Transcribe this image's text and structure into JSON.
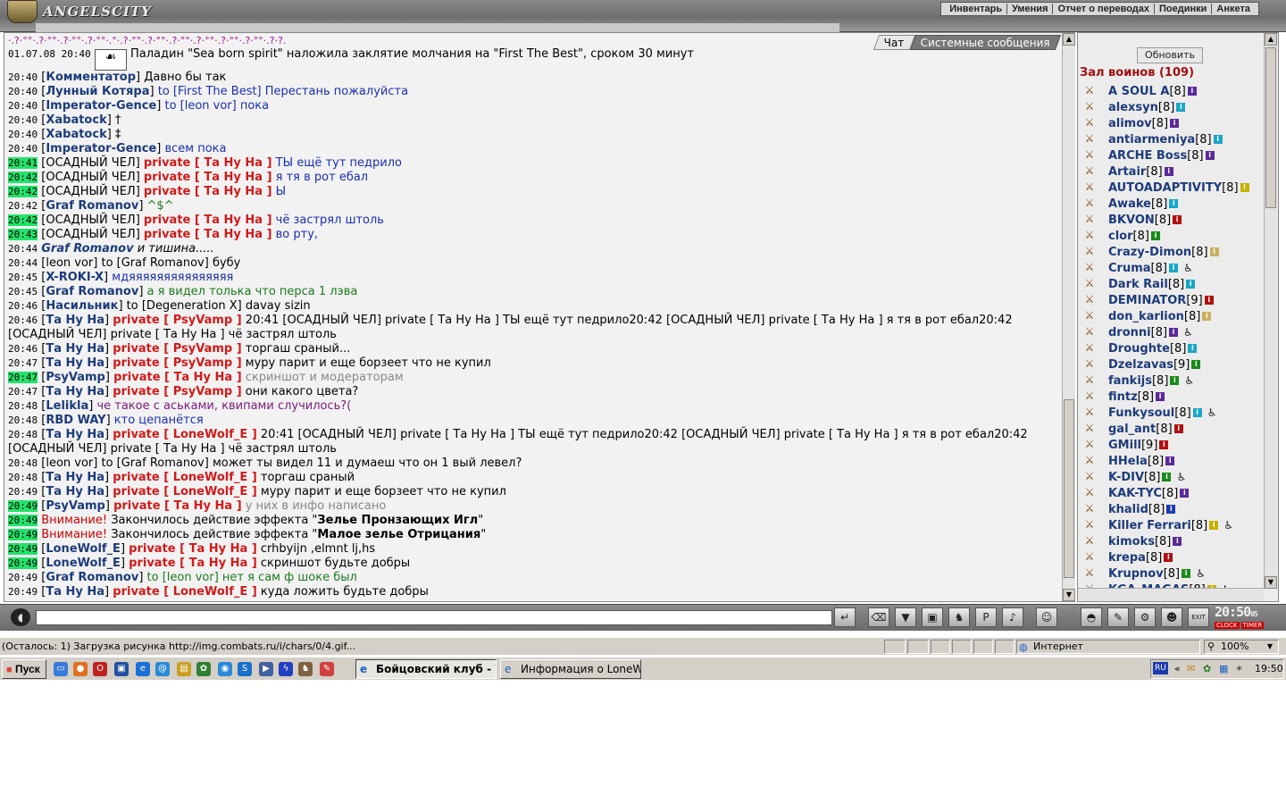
{
  "app": {
    "logo_text": "ANGELSCITY",
    "menu": [
      "Инвентарь",
      "Умения",
      "Отчет о переводах",
      "Поединки",
      "Анкета"
    ]
  },
  "chat": {
    "tabs": {
      "chat": "Чат",
      "system": "Системные сообщения"
    },
    "header_pattern": "·.?·°°·.?·°°·.?·°°·.?·°°·.°·.?·°°·.?·°°·.?·°°·.?·°°·.?·°°·.?·°°·.?·?.",
    "lines": [
      {
        "time": "01.07.08 20:40",
        "hl": false,
        "spell_icon": true,
        "parts": [
          {
            "c": "plain",
            "v": " Паладин \"Sea born spirit\" наложила заклятие молчания на \"First The Best\", сроком 30 минут"
          }
        ]
      },
      {
        "time": "20:40",
        "hl": false,
        "parts": [
          {
            "c": "plain",
            "v": "["
          },
          {
            "c": "nick",
            "v": "Комментатор"
          },
          {
            "c": "plain",
            "v": "] Давно бы так"
          }
        ]
      },
      {
        "time": "20:40",
        "hl": false,
        "parts": [
          {
            "c": "plain",
            "v": "["
          },
          {
            "c": "nick",
            "v": "Лунный Котяра"
          },
          {
            "c": "plain",
            "v": "] "
          },
          {
            "c": "txt-pv",
            "v": "to [First The Best] Перестань пожалуйста"
          }
        ]
      },
      {
        "time": "20:40",
        "hl": false,
        "parts": [
          {
            "c": "plain",
            "v": "["
          },
          {
            "c": "nick",
            "v": "Imperator-Gence"
          },
          {
            "c": "plain",
            "v": "] "
          },
          {
            "c": "txt-pv",
            "v": "to [leon vor] пока"
          }
        ]
      },
      {
        "time": "20:40",
        "hl": false,
        "parts": [
          {
            "c": "plain",
            "v": "["
          },
          {
            "c": "nick",
            "v": "Xabatock"
          },
          {
            "c": "plain",
            "v": "] †"
          }
        ]
      },
      {
        "time": "20:40",
        "hl": false,
        "parts": [
          {
            "c": "plain",
            "v": "["
          },
          {
            "c": "nick",
            "v": "Xabatock"
          },
          {
            "c": "plain",
            "v": "] ‡"
          }
        ]
      },
      {
        "time": "20:40",
        "hl": false,
        "parts": [
          {
            "c": "plain",
            "v": "["
          },
          {
            "c": "nick",
            "v": "Imperator-Gence"
          },
          {
            "c": "plain",
            "v": "] "
          },
          {
            "c": "txt-pv",
            "v": "всем пока"
          }
        ]
      },
      {
        "time": "20:41",
        "hl": true,
        "parts": [
          {
            "c": "plain",
            "v": "[ОСАДНЫЙ ЧЕЛ] "
          },
          {
            "c": "pv",
            "v": "private [ Та Ну На ]"
          },
          {
            "c": "txt-pv",
            "v": " ТЫ ещё тут педрило"
          }
        ]
      },
      {
        "time": "20:42",
        "hl": true,
        "parts": [
          {
            "c": "plain",
            "v": "[ОСАДНЫЙ ЧЕЛ] "
          },
          {
            "c": "pv",
            "v": "private [ Та Ну На ]"
          },
          {
            "c": "txt-pv",
            "v": " я тя в рот ебал"
          }
        ]
      },
      {
        "time": "20:42",
        "hl": true,
        "parts": [
          {
            "c": "plain",
            "v": "[ОСАДНЫЙ ЧЕЛ] "
          },
          {
            "c": "pv",
            "v": "private [ Та Ну На ]"
          },
          {
            "c": "txt-pv",
            "v": " Ы"
          }
        ]
      },
      {
        "time": "20:42",
        "hl": false,
        "parts": [
          {
            "c": "plain",
            "v": "["
          },
          {
            "c": "nick",
            "v": "Graf Romanov"
          },
          {
            "c": "plain",
            "v": "] "
          },
          {
            "c": "txt-g",
            "v": "^$^"
          }
        ]
      },
      {
        "time": "20:42",
        "hl": true,
        "parts": [
          {
            "c": "plain",
            "v": "[ОСАДНЫЙ ЧЕЛ] "
          },
          {
            "c": "pv",
            "v": "private [ Та Ну На ]"
          },
          {
            "c": "txt-pv",
            "v": " чё застрял штоль"
          }
        ]
      },
      {
        "time": "20:43",
        "hl": true,
        "parts": [
          {
            "c": "plain",
            "v": "[ОСАДНЫЙ ЧЕЛ] "
          },
          {
            "c": "pv",
            "v": "private [ Та Ну На ]"
          },
          {
            "c": "txt-pv",
            "v": " во рту,"
          }
        ]
      },
      {
        "time": "20:44",
        "hl": false,
        "parts": [
          {
            "c": "nick it",
            "v": "Graf Romanov"
          },
          {
            "c": "it",
            "v": " и тишина....."
          }
        ]
      },
      {
        "time": "20:44",
        "hl": false,
        "parts": [
          {
            "c": "plain",
            "v": "[leon vor] to [Graf Romanov] бубу"
          }
        ]
      },
      {
        "time": "20:45",
        "hl": false,
        "parts": [
          {
            "c": "plain",
            "v": "["
          },
          {
            "c": "nick",
            "v": "X-ROKI-X"
          },
          {
            "c": "plain",
            "v": "] "
          },
          {
            "c": "txt-pv",
            "v": "мдяяяяяяяяяяяяяяя"
          }
        ]
      },
      {
        "time": "20:45",
        "hl": false,
        "parts": [
          {
            "c": "plain",
            "v": "["
          },
          {
            "c": "nick",
            "v": "Graf Romanov"
          },
          {
            "c": "plain",
            "v": "] "
          },
          {
            "c": "txt-g",
            "v": "а я видел толька что перса 1 лэва"
          }
        ]
      },
      {
        "time": "20:46",
        "hl": false,
        "parts": [
          {
            "c": "plain",
            "v": "["
          },
          {
            "c": "nick",
            "v": "Насильник"
          },
          {
            "c": "plain",
            "v": "] to [Degeneration X] davay sizin"
          }
        ]
      },
      {
        "time": "20:46",
        "hl": false,
        "parts": [
          {
            "c": "plain",
            "v": "["
          },
          {
            "c": "nick",
            "v": "Та Ну На"
          },
          {
            "c": "plain",
            "v": "] "
          },
          {
            "c": "pv",
            "v": "private [ PsyVamp ]"
          },
          {
            "c": "plain",
            "v": " 20:41 [ОСАДНЫЙ ЧЕЛ] private [ Та Ну На ] ТЫ ещё тут педрило20:42 [ОСАДНЫЙ ЧЕЛ] private [ Та Ну На ] я тя в рот ебал20:42 [ОСАДНЫЙ ЧЕЛ] private [ Та Ну На ] чё застрял штоль"
          }
        ]
      },
      {
        "time": "20:46",
        "hl": false,
        "parts": [
          {
            "c": "plain",
            "v": "["
          },
          {
            "c": "nick",
            "v": "Та Ну На"
          },
          {
            "c": "plain",
            "v": "] "
          },
          {
            "c": "pv",
            "v": "private [ PsyVamp ]"
          },
          {
            "c": "plain",
            "v": " торгаш сраный..."
          }
        ]
      },
      {
        "time": "20:47",
        "hl": false,
        "parts": [
          {
            "c": "plain",
            "v": "["
          },
          {
            "c": "nick",
            "v": "Та Ну На"
          },
          {
            "c": "plain",
            "v": "] "
          },
          {
            "c": "pv",
            "v": "private [ PsyVamp ]"
          },
          {
            "c": "plain",
            "v": " муру парит и еще борзеет что не купил"
          }
        ]
      },
      {
        "time": "20:47",
        "hl": true,
        "parts": [
          {
            "c": "plain",
            "v": "["
          },
          {
            "c": "nick",
            "v": "PsyVamp"
          },
          {
            "c": "plain",
            "v": "] "
          },
          {
            "c": "pv",
            "v": "private [ Та Ну На ]"
          },
          {
            "c": "txt-gray",
            "v": " скриншот и модераторам"
          }
        ]
      },
      {
        "time": "20:47",
        "hl": false,
        "parts": [
          {
            "c": "plain",
            "v": "["
          },
          {
            "c": "nick",
            "v": "Та Ну На"
          },
          {
            "c": "plain",
            "v": "] "
          },
          {
            "c": "pv",
            "v": "private [ PsyVamp ]"
          },
          {
            "c": "plain",
            "v": " они какого цвета?"
          }
        ]
      },
      {
        "time": "20:48",
        "hl": false,
        "parts": [
          {
            "c": "plain",
            "v": "["
          },
          {
            "c": "nick",
            "v": "Lelikla"
          },
          {
            "c": "plain",
            "v": "] "
          },
          {
            "c": "txt-purple",
            "v": "че такое с аськами, квипами случилось?("
          }
        ]
      },
      {
        "time": "20:48",
        "hl": false,
        "parts": [
          {
            "c": "plain",
            "v": "["
          },
          {
            "c": "nick",
            "v": "RBD WAY"
          },
          {
            "c": "plain",
            "v": "] "
          },
          {
            "c": "txt-pv",
            "v": "кто цепанётся"
          }
        ]
      },
      {
        "time": "20:48",
        "hl": false,
        "parts": [
          {
            "c": "plain",
            "v": "["
          },
          {
            "c": "nick",
            "v": "Та Ну На"
          },
          {
            "c": "plain",
            "v": "] "
          },
          {
            "c": "pv",
            "v": "private [ LoneWolf_E ]"
          },
          {
            "c": "plain",
            "v": " 20:41 [ОСАДНЫЙ ЧЕЛ] private [ Та Ну На ] ТЫ ещё тут педрило20:42 [ОСАДНЫЙ ЧЕЛ] private [ Та Ну На ] я тя в рот ебал20:42 [ОСАДНЫЙ ЧЕЛ] private [ Та Ну На ] чё застрял штоль"
          }
        ]
      },
      {
        "time": "20:48",
        "hl": false,
        "parts": [
          {
            "c": "plain",
            "v": "[leon vor] to [Graf Romanov] может ты видел 11 и думаеш что он 1 вый левел?"
          }
        ]
      },
      {
        "time": "20:48",
        "hl": false,
        "parts": [
          {
            "c": "plain",
            "v": "["
          },
          {
            "c": "nick",
            "v": "Та Ну На"
          },
          {
            "c": "plain",
            "v": "] "
          },
          {
            "c": "pv",
            "v": "private [ LoneWolf_E ]"
          },
          {
            "c": "plain",
            "v": " торгаш сраный"
          }
        ]
      },
      {
        "time": "20:49",
        "hl": false,
        "parts": [
          {
            "c": "plain",
            "v": "["
          },
          {
            "c": "nick",
            "v": "Та Ну На"
          },
          {
            "c": "plain",
            "v": "] "
          },
          {
            "c": "pv",
            "v": "private [ LoneWolf_E ]"
          },
          {
            "c": "plain",
            "v": " муру парит и еще борзеет что не купил"
          }
        ]
      },
      {
        "time": "20:49",
        "hl": true,
        "parts": [
          {
            "c": "plain",
            "v": "["
          },
          {
            "c": "nick",
            "v": "PsyVamp"
          },
          {
            "c": "plain",
            "v": "] "
          },
          {
            "c": "pv",
            "v": "private [ Та Ну На ]"
          },
          {
            "c": "txt-gray",
            "v": " у них в инфо написано"
          }
        ]
      },
      {
        "time": "20:49",
        "hl": true,
        "parts": [
          {
            "c": "warn",
            "v": "Внимание!"
          },
          {
            "c": "plain",
            "v": " Закончилось действие эффекта \""
          },
          {
            "c": "b",
            "v": "Зелье Пронзающих Игл"
          },
          {
            "c": "plain",
            "v": "\""
          }
        ]
      },
      {
        "time": "20:49",
        "hl": true,
        "parts": [
          {
            "c": "warn",
            "v": "Внимание!"
          },
          {
            "c": "plain",
            "v": " Закончилось действие эффекта \""
          },
          {
            "c": "b",
            "v": "Малое зелье Отрицания"
          },
          {
            "c": "plain",
            "v": "\""
          }
        ]
      },
      {
        "time": "20:49",
        "hl": true,
        "parts": [
          {
            "c": "plain",
            "v": "["
          },
          {
            "c": "nick",
            "v": "LoneWolf_E"
          },
          {
            "c": "plain",
            "v": "] "
          },
          {
            "c": "pv",
            "v": "private [ Та Ну На ]"
          },
          {
            "c": "plain",
            "v": " crhbyijn ,elmnt lj,hs"
          }
        ]
      },
      {
        "time": "20:49",
        "hl": true,
        "parts": [
          {
            "c": "plain",
            "v": "["
          },
          {
            "c": "nick",
            "v": "LoneWolf_E"
          },
          {
            "c": "plain",
            "v": "] "
          },
          {
            "c": "pv",
            "v": "private [ Та Ну На ]"
          },
          {
            "c": "plain",
            "v": " скриншот будьте добры"
          }
        ]
      },
      {
        "time": "20:49",
        "hl": false,
        "parts": [
          {
            "c": "plain",
            "v": "["
          },
          {
            "c": "nick",
            "v": "Graf Romanov"
          },
          {
            "c": "plain",
            "v": "] "
          },
          {
            "c": "txt-g",
            "v": "to [leon vor] нет я сам ф шоке был"
          }
        ]
      },
      {
        "time": "20:49",
        "hl": false,
        "parts": [
          {
            "c": "plain",
            "v": "["
          },
          {
            "c": "nick",
            "v": "Та Ну На"
          },
          {
            "c": "plain",
            "v": "] "
          },
          {
            "c": "pv",
            "v": "private [ LoneWolf_E ]"
          },
          {
            "c": "plain",
            "v": " куда ложить будьте добры"
          }
        ]
      }
    ]
  },
  "sidebar": {
    "refresh_label": "Обновить",
    "hall_title": "Зал воинов (109)",
    "users": [
      {
        "name": "A SOUL A",
        "level": "[8]",
        "info": "#5a2a9a",
        "injury": false
      },
      {
        "name": "alexsyn",
        "level": "[8]",
        "info": "#19a7c8",
        "injury": false
      },
      {
        "name": "alimov",
        "level": "[8]",
        "info": "#5a2a9a",
        "injury": false
      },
      {
        "name": "antiarmeniya",
        "level": "[8]",
        "info": "#19a7c8",
        "injury": false
      },
      {
        "name": "ARCHE Boss",
        "level": "[8]",
        "info": "#5a2a9a",
        "injury": false
      },
      {
        "name": "Artair",
        "level": "[8]",
        "info": "#5a2a9a",
        "injury": false
      },
      {
        "name": "AUTOADAPTIVITY",
        "level": "[8]",
        "info": "#c8b000",
        "injury": false
      },
      {
        "name": "Awake",
        "level": "[8]",
        "info": "#19a7c8",
        "injury": false
      },
      {
        "name": "BKVON",
        "level": "[8]",
        "info": "#b01010",
        "injury": false
      },
      {
        "name": "clor",
        "level": "[8]",
        "info": "#1a8a1a",
        "injury": false
      },
      {
        "name": "Crazy-Dimon",
        "level": "[8]",
        "info": "#c8b060",
        "injury": false
      },
      {
        "name": "Cruma",
        "level": "[8]",
        "info": "#19a7c8",
        "injury": true
      },
      {
        "name": "Dark Rail",
        "level": "[8]",
        "info": "#19a7c8",
        "injury": false
      },
      {
        "name": "DEMINATOR",
        "level": "[9]",
        "info": "#b01010",
        "injury": false
      },
      {
        "name": "don_karlion",
        "level": "[8]",
        "info": "#c8b060",
        "injury": false
      },
      {
        "name": "dronni",
        "level": "[8]",
        "info": "#5a2a9a",
        "injury": true
      },
      {
        "name": "Droughte",
        "level": "[8]",
        "info": "#19a7c8",
        "injury": false
      },
      {
        "name": "Dzelzavas",
        "level": "[9]",
        "info": "#1a8a1a",
        "injury": false
      },
      {
        "name": "fankijs",
        "level": "[8]",
        "info": "#1a8a1a",
        "injury": true
      },
      {
        "name": "fintz",
        "level": "[8]",
        "info": "#5a2a9a",
        "injury": false
      },
      {
        "name": "Funkysoul",
        "level": "[8]",
        "info": "#19a7c8",
        "injury": true
      },
      {
        "name": "gal_ant",
        "level": "[8]",
        "info": "#b01010",
        "injury": false
      },
      {
        "name": "GMill",
        "level": "[9]",
        "info": "#b01010",
        "injury": false
      },
      {
        "name": "HHela",
        "level": "[8]",
        "info": "#5a2a9a",
        "injury": false
      },
      {
        "name": "K-DIV",
        "level": "[8]",
        "info": "#1a8a1a",
        "injury": true
      },
      {
        "name": "KAK-TYC",
        "level": "[8]",
        "info": "#5a2a9a",
        "injury": false
      },
      {
        "name": "khalid",
        "level": "[8]",
        "info": "#1a3ab0",
        "injury": false
      },
      {
        "name": "Killer Ferrari",
        "level": "[8]",
        "info": "#c8b000",
        "injury": true
      },
      {
        "name": "kimoks",
        "level": "[8]",
        "info": "#5a2a9a",
        "injury": false
      },
      {
        "name": "krepa",
        "level": "[8]",
        "info": "#b01010",
        "injury": false
      },
      {
        "name": "Krupnov",
        "level": "[8]",
        "info": "#1a8a1a",
        "injury": true
      },
      {
        "name": "KGA_MAGAS",
        "level": "[8]",
        "info": "#c8b000",
        "injury": true
      }
    ]
  },
  "input": {
    "placeholder": ""
  },
  "clock": {
    "time": "20:50",
    "seconds": "05",
    "clock_label": "CLOCK",
    "timer_label": "TIMER",
    "exit_label": "EXIT"
  },
  "statusbar": {
    "text": "(Осталось: 1) Загрузка рисунка http://img.combats.ru/i/chars/0/4.gif...",
    "zone": "Интернет",
    "zoom": "100%"
  },
  "taskbar": {
    "start_label": "Пуск",
    "tasks": [
      "Бойцовский клуб - Wi...",
      "Информация о LoneWolf..."
    ],
    "lang": "RU",
    "time": "19:50"
  },
  "colors": {
    "highlight": "#22e26a",
    "private": "#d21a1a",
    "nick": "#1c3b7a",
    "hall_title": "#a01010"
  }
}
